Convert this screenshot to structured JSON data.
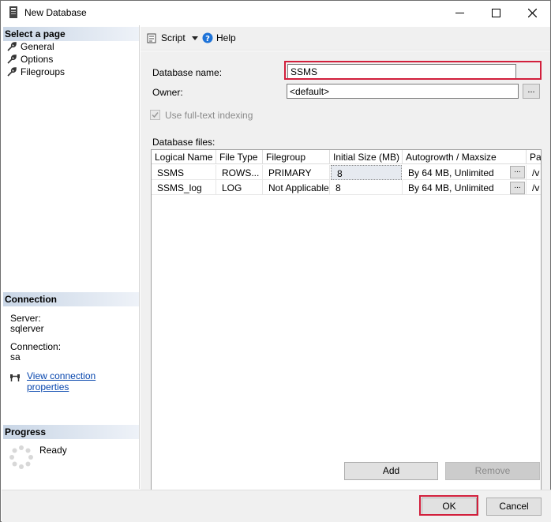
{
  "window": {
    "title": "New Database",
    "controls": {
      "minimize": "minimize-icon",
      "maximize": "maximize-icon",
      "close": "close-icon"
    }
  },
  "left_panel": {
    "select_page_header": "Select a page",
    "pages": [
      {
        "label": "General",
        "icon": "wrench-icon"
      },
      {
        "label": "Options",
        "icon": "wrench-icon"
      },
      {
        "label": "Filegroups",
        "icon": "wrench-icon"
      }
    ],
    "connection_header": "Connection",
    "server_label": "Server:",
    "server_value": "sqlerver",
    "connection_label": "Connection:",
    "connection_value": "sa",
    "view_connection_link": "View connection properties",
    "progress_header": "Progress",
    "progress_status": "Ready"
  },
  "toolbar": {
    "script_label": "Script",
    "help_label": "Help"
  },
  "general": {
    "db_name_label": "Database name:",
    "db_name_value": "SSMS",
    "owner_label": "Owner:",
    "owner_value": "<default>",
    "fulltext_label": "Use full-text indexing",
    "fulltext_checked": true,
    "database_files_label": "Database files:",
    "columns": [
      "Logical Name",
      "File Type",
      "Filegroup",
      "Initial Size (MB)",
      "Autogrowth / Maxsize",
      "Pa"
    ],
    "rows": [
      {
        "logical_name": "SSMS",
        "file_type": "ROWS...",
        "filegroup": "PRIMARY",
        "initial_size": "8",
        "autogrowth": "By 64 MB, Unlimited",
        "path": "/v"
      },
      {
        "logical_name": "SSMS_log",
        "file_type": "LOG",
        "filegroup": "Not Applicable",
        "initial_size": "8",
        "autogrowth": "By 64 MB, Unlimited",
        "path": "/v"
      }
    ],
    "ellipsis_label": "...",
    "add_label": "Add",
    "remove_label": "Remove"
  },
  "footer": {
    "ok_label": "OK",
    "cancel_label": "Cancel"
  },
  "colors": {
    "highlight": "#d21f3c",
    "link": "#0645ad",
    "panel_bg": "#f0f0f0"
  }
}
